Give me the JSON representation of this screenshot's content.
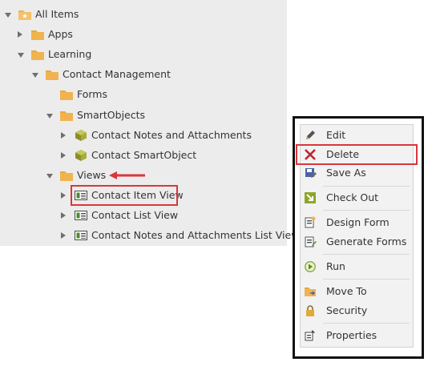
{
  "tree": {
    "items": [
      {
        "label": "All Items",
        "icon": "folder-star-icon",
        "state": "expanded"
      },
      {
        "label": "Apps",
        "icon": "folder-icon",
        "state": "collapsed"
      },
      {
        "label": "Learning",
        "icon": "folder-icon",
        "state": "expanded"
      },
      {
        "label": "Contact Management",
        "icon": "folder-icon",
        "state": "expanded"
      },
      {
        "label": "Forms",
        "icon": "folder-icon",
        "state": "none"
      },
      {
        "label": "SmartObjects",
        "icon": "folder-icon",
        "state": "expanded"
      },
      {
        "label": "Contact Notes and Attachments",
        "icon": "smartobject-icon",
        "state": "collapsed"
      },
      {
        "label": "Contact SmartObject",
        "icon": "smartobject-icon",
        "state": "collapsed"
      },
      {
        "label": "Views",
        "icon": "folder-icon",
        "state": "expanded"
      },
      {
        "label": "Contact Item View",
        "icon": "view-icon",
        "state": "collapsed"
      },
      {
        "label": "Contact List View",
        "icon": "view-icon",
        "state": "collapsed"
      },
      {
        "label": "Contact Notes and Attachments List View",
        "icon": "view-icon",
        "state": "collapsed"
      }
    ]
  },
  "context_menu": {
    "items": [
      {
        "label": "Edit",
        "icon": "pencil-icon"
      },
      {
        "label": "Delete",
        "icon": "delete-x-icon"
      },
      {
        "label": "Save As",
        "icon": "save-as-icon"
      },
      {
        "label": "Check Out",
        "icon": "check-out-icon"
      },
      {
        "label": "Design Form",
        "icon": "design-form-icon"
      },
      {
        "label": "Generate Forms",
        "icon": "generate-forms-icon"
      },
      {
        "label": "Run",
        "icon": "run-icon"
      },
      {
        "label": "Move To",
        "icon": "move-to-icon"
      },
      {
        "label": "Security",
        "icon": "lock-icon"
      },
      {
        "label": "Properties",
        "icon": "properties-icon"
      }
    ]
  },
  "colors": {
    "folder": "#f0b350",
    "highlight": "#d9363e",
    "panel_bg": "#ececec"
  }
}
